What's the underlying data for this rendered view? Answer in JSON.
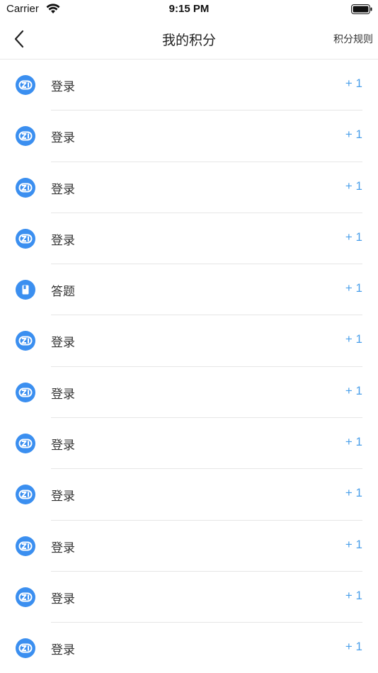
{
  "status_bar": {
    "carrier": "Carrier",
    "time": "9:15 PM"
  },
  "nav": {
    "title": "我的积分",
    "rules_label": "积分规则"
  },
  "colors": {
    "accent": "#4a9fea",
    "icon_blue": "#3b8ff0"
  },
  "records": [
    {
      "label": "登录",
      "points": "+ 1",
      "icon": "login-icon"
    },
    {
      "label": "登录",
      "points": "+ 1",
      "icon": "login-icon"
    },
    {
      "label": "登录",
      "points": "+ 1",
      "icon": "login-icon"
    },
    {
      "label": "登录",
      "points": "+ 1",
      "icon": "login-icon"
    },
    {
      "label": "答题",
      "points": "+ 1",
      "icon": "quiz-icon"
    },
    {
      "label": "登录",
      "points": "+ 1",
      "icon": "login-icon"
    },
    {
      "label": "登录",
      "points": "+ 1",
      "icon": "login-icon"
    },
    {
      "label": "登录",
      "points": "+ 1",
      "icon": "login-icon"
    },
    {
      "label": "登录",
      "points": "+ 1",
      "icon": "login-icon"
    },
    {
      "label": "登录",
      "points": "+ 1",
      "icon": "login-icon"
    },
    {
      "label": "登录",
      "points": "+ 1",
      "icon": "login-icon"
    },
    {
      "label": "登录",
      "points": "+ 1",
      "icon": "login-icon"
    }
  ]
}
